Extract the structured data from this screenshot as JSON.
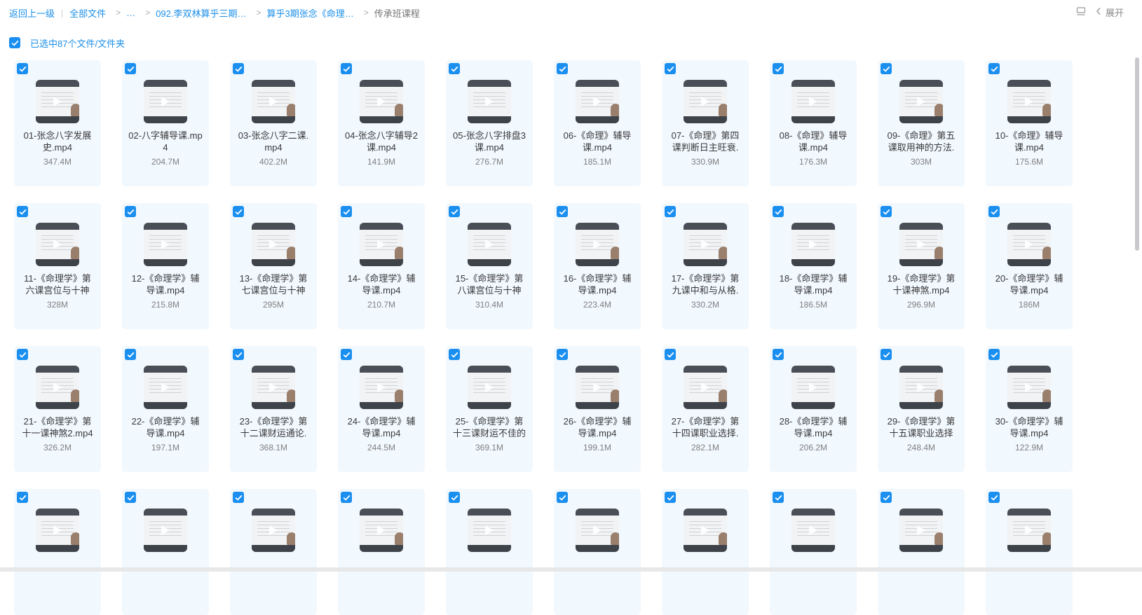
{
  "breadcrumb": {
    "back": "返回上一级",
    "all_files": "全部文件",
    "ellipsis": "…",
    "folder1": "092.李双林算乎三期…",
    "folder2": "算乎3期张念《命理…",
    "current": "传承班课程"
  },
  "toolbar": {
    "expand_label": "展开",
    "layout_icon": "layout-icon",
    "chevron": "chevron-left-icon"
  },
  "selection": {
    "label": "已选中87个文件/文件夹"
  },
  "files": [
    {
      "name": "01-张念八字发展史.mp4",
      "size": "347.4M"
    },
    {
      "name": "02-八字辅导课.mp4",
      "size": "204.7M"
    },
    {
      "name": "03-张念八字二课.mp4",
      "size": "402.2M"
    },
    {
      "name": "04-张念八字辅导2课.mp4",
      "size": "141.9M"
    },
    {
      "name": "05-张念八字排盘3课.mp4",
      "size": "276.7M"
    },
    {
      "name": "06-《命理》辅导课.mp4",
      "size": "185.1M"
    },
    {
      "name": "07-《命理》第四课判断日主旺衰.m...",
      "size": "330.9M"
    },
    {
      "name": "08-《命理》辅导课.mp4",
      "size": "176.3M"
    },
    {
      "name": "09-《命理》第五课取用神的方法.",
      "size": "303M"
    },
    {
      "name": "10-《命理》辅导课.mp4",
      "size": "175.6M"
    },
    {
      "name": "11-《命理学》第六课宫位与十神（1...",
      "size": "328M"
    },
    {
      "name": "12-《命理学》辅导课.mp4",
      "size": "215.8M"
    },
    {
      "name": "13-《命理学》第七课宫位与十神2....",
      "size": "295M"
    },
    {
      "name": "14-《命理学》辅导课.mp4",
      "size": "210.7M"
    },
    {
      "name": "15-《命理学》第八课宫位与十神3....",
      "size": "310.4M"
    },
    {
      "name": "16-《命理学》辅导课.mp4",
      "size": "223.4M"
    },
    {
      "name": "17-《命理学》第九课中和与从格.m...",
      "size": "330.2M"
    },
    {
      "name": "18-《命理学》辅导课.mp4",
      "size": "186.5M"
    },
    {
      "name": "19-《命理学》第十课神煞.mp4",
      "size": "296.9M"
    },
    {
      "name": "20-《命理学》辅导课.mp4",
      "size": "186M"
    },
    {
      "name": "21-《命理学》第十一课神煞2.mp4",
      "size": "326.2M"
    },
    {
      "name": "22-《命理学》辅导课.mp4",
      "size": "197.1M"
    },
    {
      "name": "23-《命理学》第十二课财运通论.",
      "size": "368.1M"
    },
    {
      "name": "24-《命理学》辅导课.mp4",
      "size": "244.5M"
    },
    {
      "name": "25-《命理学》第十三课财运不佳的",
      "size": "369.1M"
    },
    {
      "name": "26-《命理学》辅导课.mp4",
      "size": "199.1M"
    },
    {
      "name": "27-《命理学》第十四课职业选择.m...",
      "size": "282.1M"
    },
    {
      "name": "28-《命理学》辅导课.mp4",
      "size": "206.2M"
    },
    {
      "name": "29-《命理学》第十五课职业选择",
      "size": "248.4M"
    },
    {
      "name": "30-《命理学》辅导课.mp4",
      "size": "122.9M"
    },
    {
      "name": "",
      "size": ""
    },
    {
      "name": "",
      "size": ""
    },
    {
      "name": "",
      "size": ""
    },
    {
      "name": "",
      "size": ""
    },
    {
      "name": "",
      "size": ""
    },
    {
      "name": "",
      "size": ""
    },
    {
      "name": "",
      "size": ""
    },
    {
      "name": "",
      "size": ""
    },
    {
      "name": "",
      "size": ""
    },
    {
      "name": "",
      "size": ""
    }
  ]
}
